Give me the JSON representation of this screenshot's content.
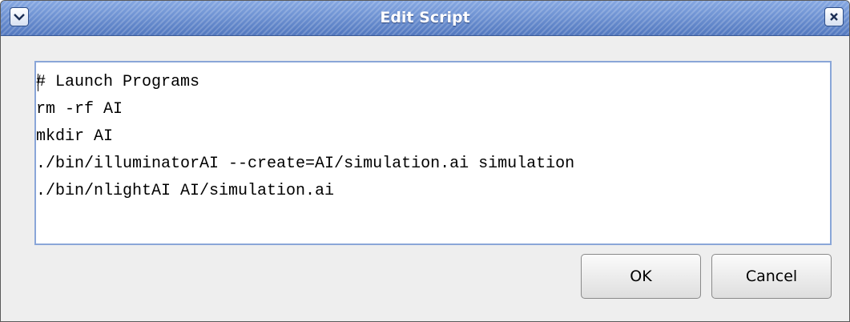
{
  "window": {
    "title": "Edit Script",
    "menu_icon": "chevron-down-icon",
    "close_icon": "close-icon"
  },
  "editor": {
    "lines": [
      "# Launch Programs",
      "rm -rf AI",
      "mkdir AI",
      "./bin/illuminatorAI --create=AI/simulation.ai simulation",
      "./bin/nlightAI AI/simulation.ai"
    ]
  },
  "buttons": {
    "ok_label": "OK",
    "cancel_label": "Cancel"
  },
  "colors": {
    "titlebar": "#6a8fd0",
    "editor_border": "#8aa6d8",
    "dialog_background": "#eeeeee"
  }
}
